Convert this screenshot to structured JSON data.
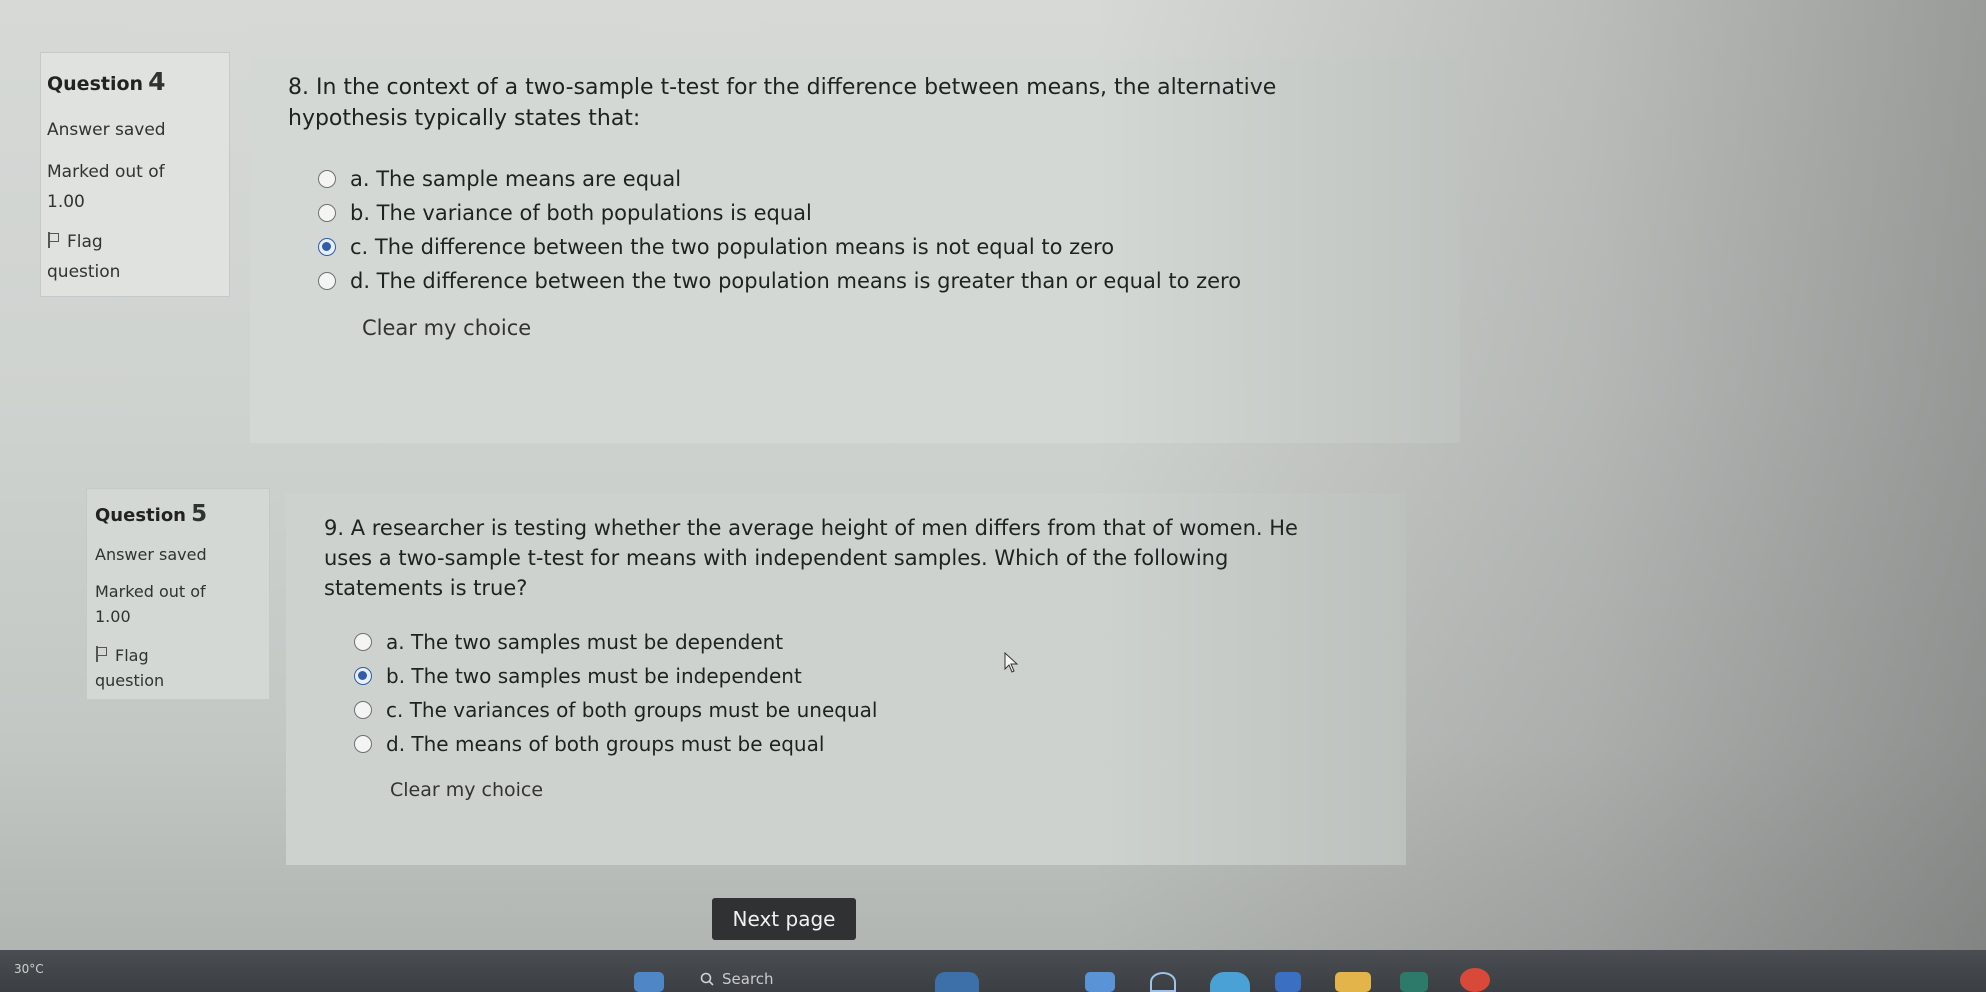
{
  "q4": {
    "label": "Question",
    "number": "4",
    "status": "Answer saved",
    "marked_label": "Marked out of",
    "marked_value": "1.00",
    "flag_label_1": "Flag",
    "flag_label_2": "question",
    "text_line1": "8. In the context of a two-sample t-test for the difference between means, the alternative",
    "text_line2": "hypothesis typically states that:",
    "options": [
      {
        "text": "a.  The sample means are equal",
        "selected": false
      },
      {
        "text": "b.  The variance of both populations is equal",
        "selected": false
      },
      {
        "text": "c.  The difference between the two population means is not equal to zero",
        "selected": true
      },
      {
        "text": "d.  The difference between the two population means is greater than or equal to zero",
        "selected": false
      }
    ],
    "clear": "Clear my choice"
  },
  "q5": {
    "label": "Question",
    "number": "5",
    "status": "Answer saved",
    "marked_label": "Marked out of",
    "marked_value": "1.00",
    "flag_label_1": "Flag",
    "flag_label_2": "question",
    "text_line1": "9. A researcher is testing whether the average height of men differs from that of women. He",
    "text_line2": "uses a two-sample t-test for means with independent samples. Which of the following",
    "text_line3": "statements is true?",
    "options": [
      {
        "text": "a.  The two samples must be dependent",
        "selected": false
      },
      {
        "text": "b.  The two samples must be independent",
        "selected": true
      },
      {
        "text": "c.  The variances of both groups must be unequal",
        "selected": false
      },
      {
        "text": "d.  The means of both groups must be equal",
        "selected": false
      }
    ],
    "clear": "Clear my choice"
  },
  "nav": {
    "next": "Next page"
  },
  "taskbar": {
    "temperature": "30°C",
    "search": "Search"
  },
  "colors": {
    "radio_selected": "#2e5ea8",
    "button_bg": "#2f3132"
  }
}
